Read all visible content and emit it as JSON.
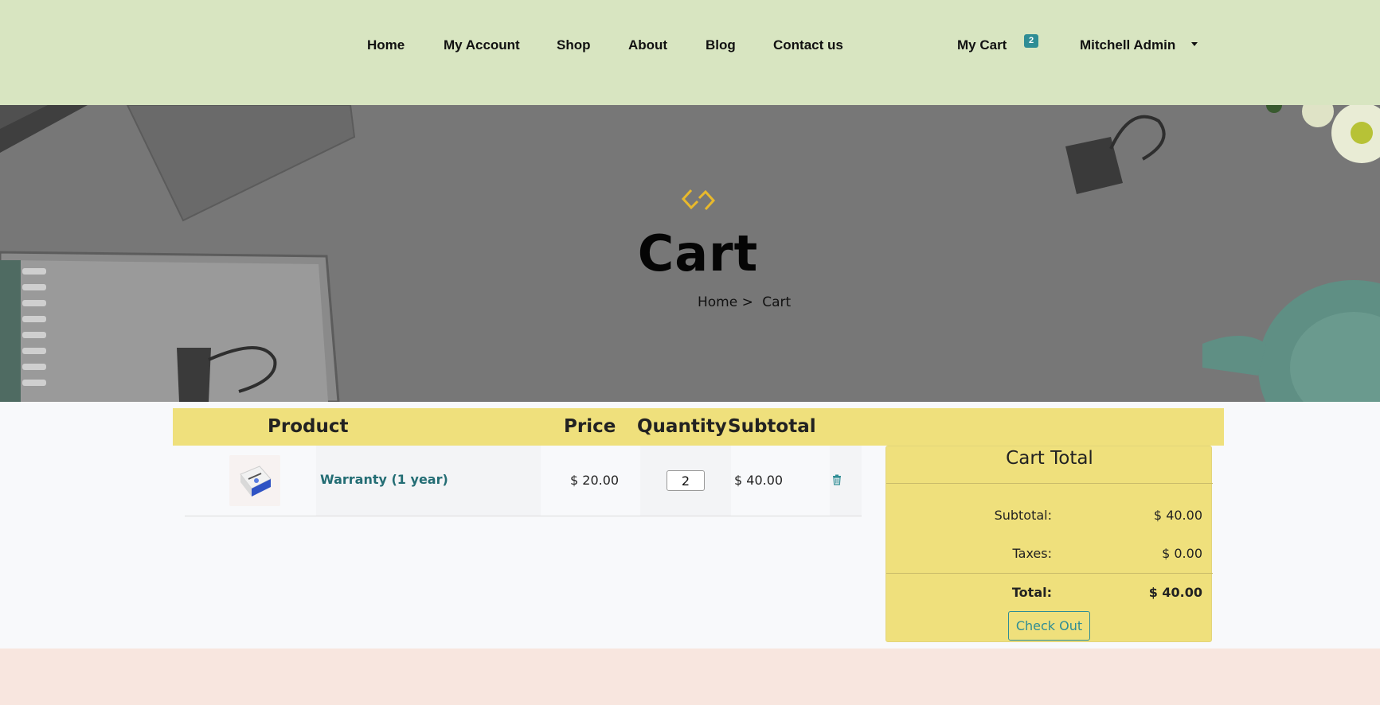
{
  "nav": {
    "items": [
      "Home",
      "My Account",
      "Shop",
      "About",
      "Blog",
      "Contact us"
    ],
    "cart_label": "My Cart",
    "cart_count": "2",
    "user_name": "Mitchell Admin"
  },
  "hero": {
    "title": "Cart",
    "breadcrumb_home": "Home >",
    "breadcrumb_current": "Cart"
  },
  "table": {
    "headers": {
      "product": "Product",
      "price": "Price",
      "quantity": "Quantity",
      "subtotal": "Subtotal"
    },
    "rows": [
      {
        "name": "Warranty (1 year)",
        "price": "$ 20.00",
        "quantity": "2",
        "subtotal": "$ 40.00"
      }
    ]
  },
  "totals": {
    "title": "Cart Total",
    "subtotal_label": "Subtotal:",
    "subtotal_value": "$ 40.00",
    "taxes_label": "Taxes:",
    "taxes_value": "$ 0.00",
    "total_label": "Total:",
    "total_value": "$ 40.00",
    "checkout_label": "Check Out"
  },
  "colors": {
    "header_bg": "#d8e5c1",
    "table_header_bg": "#efe07c",
    "accent": "#2f8d95",
    "footer_bg": "#f8e6df"
  }
}
